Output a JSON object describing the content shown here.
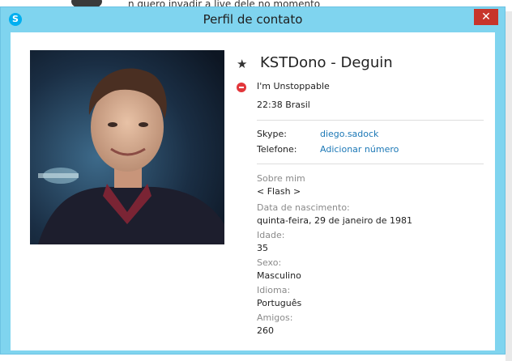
{
  "background": {
    "chat_text": "n quero invadir a live dele no momento"
  },
  "window": {
    "title": "Perfil de contato",
    "app_icon_glyph": "S",
    "close_glyph": "✕"
  },
  "profile": {
    "display_name": "KSTDono - Deguin",
    "mood": "I'm Unstoppable",
    "local_time": "22:38 Brasil",
    "contacts": [
      {
        "label": "Skype:",
        "value": "diego.sadock"
      },
      {
        "label": "Telefone:",
        "value": "Adicionar número"
      }
    ],
    "details": [
      {
        "label": "Sobre mim",
        "value": "< Flash >"
      },
      {
        "label": "Data de nascimento:",
        "value": "quinta-feira, 29 de janeiro de 1981"
      },
      {
        "label": "Idade:",
        "value": "35"
      },
      {
        "label": "Sexo:",
        "value": "Masculino"
      },
      {
        "label": "Idioma:",
        "value": "Português"
      },
      {
        "label": "Amigos:",
        "value": "260"
      }
    ]
  },
  "colors": {
    "frame": "#7fd4ef",
    "close": "#c7352b",
    "link": "#1c78b6",
    "status_busy": "#e2363b"
  },
  "icons": {
    "favorite": "star-icon",
    "status": "busy-status-icon",
    "app": "skype-icon"
  }
}
